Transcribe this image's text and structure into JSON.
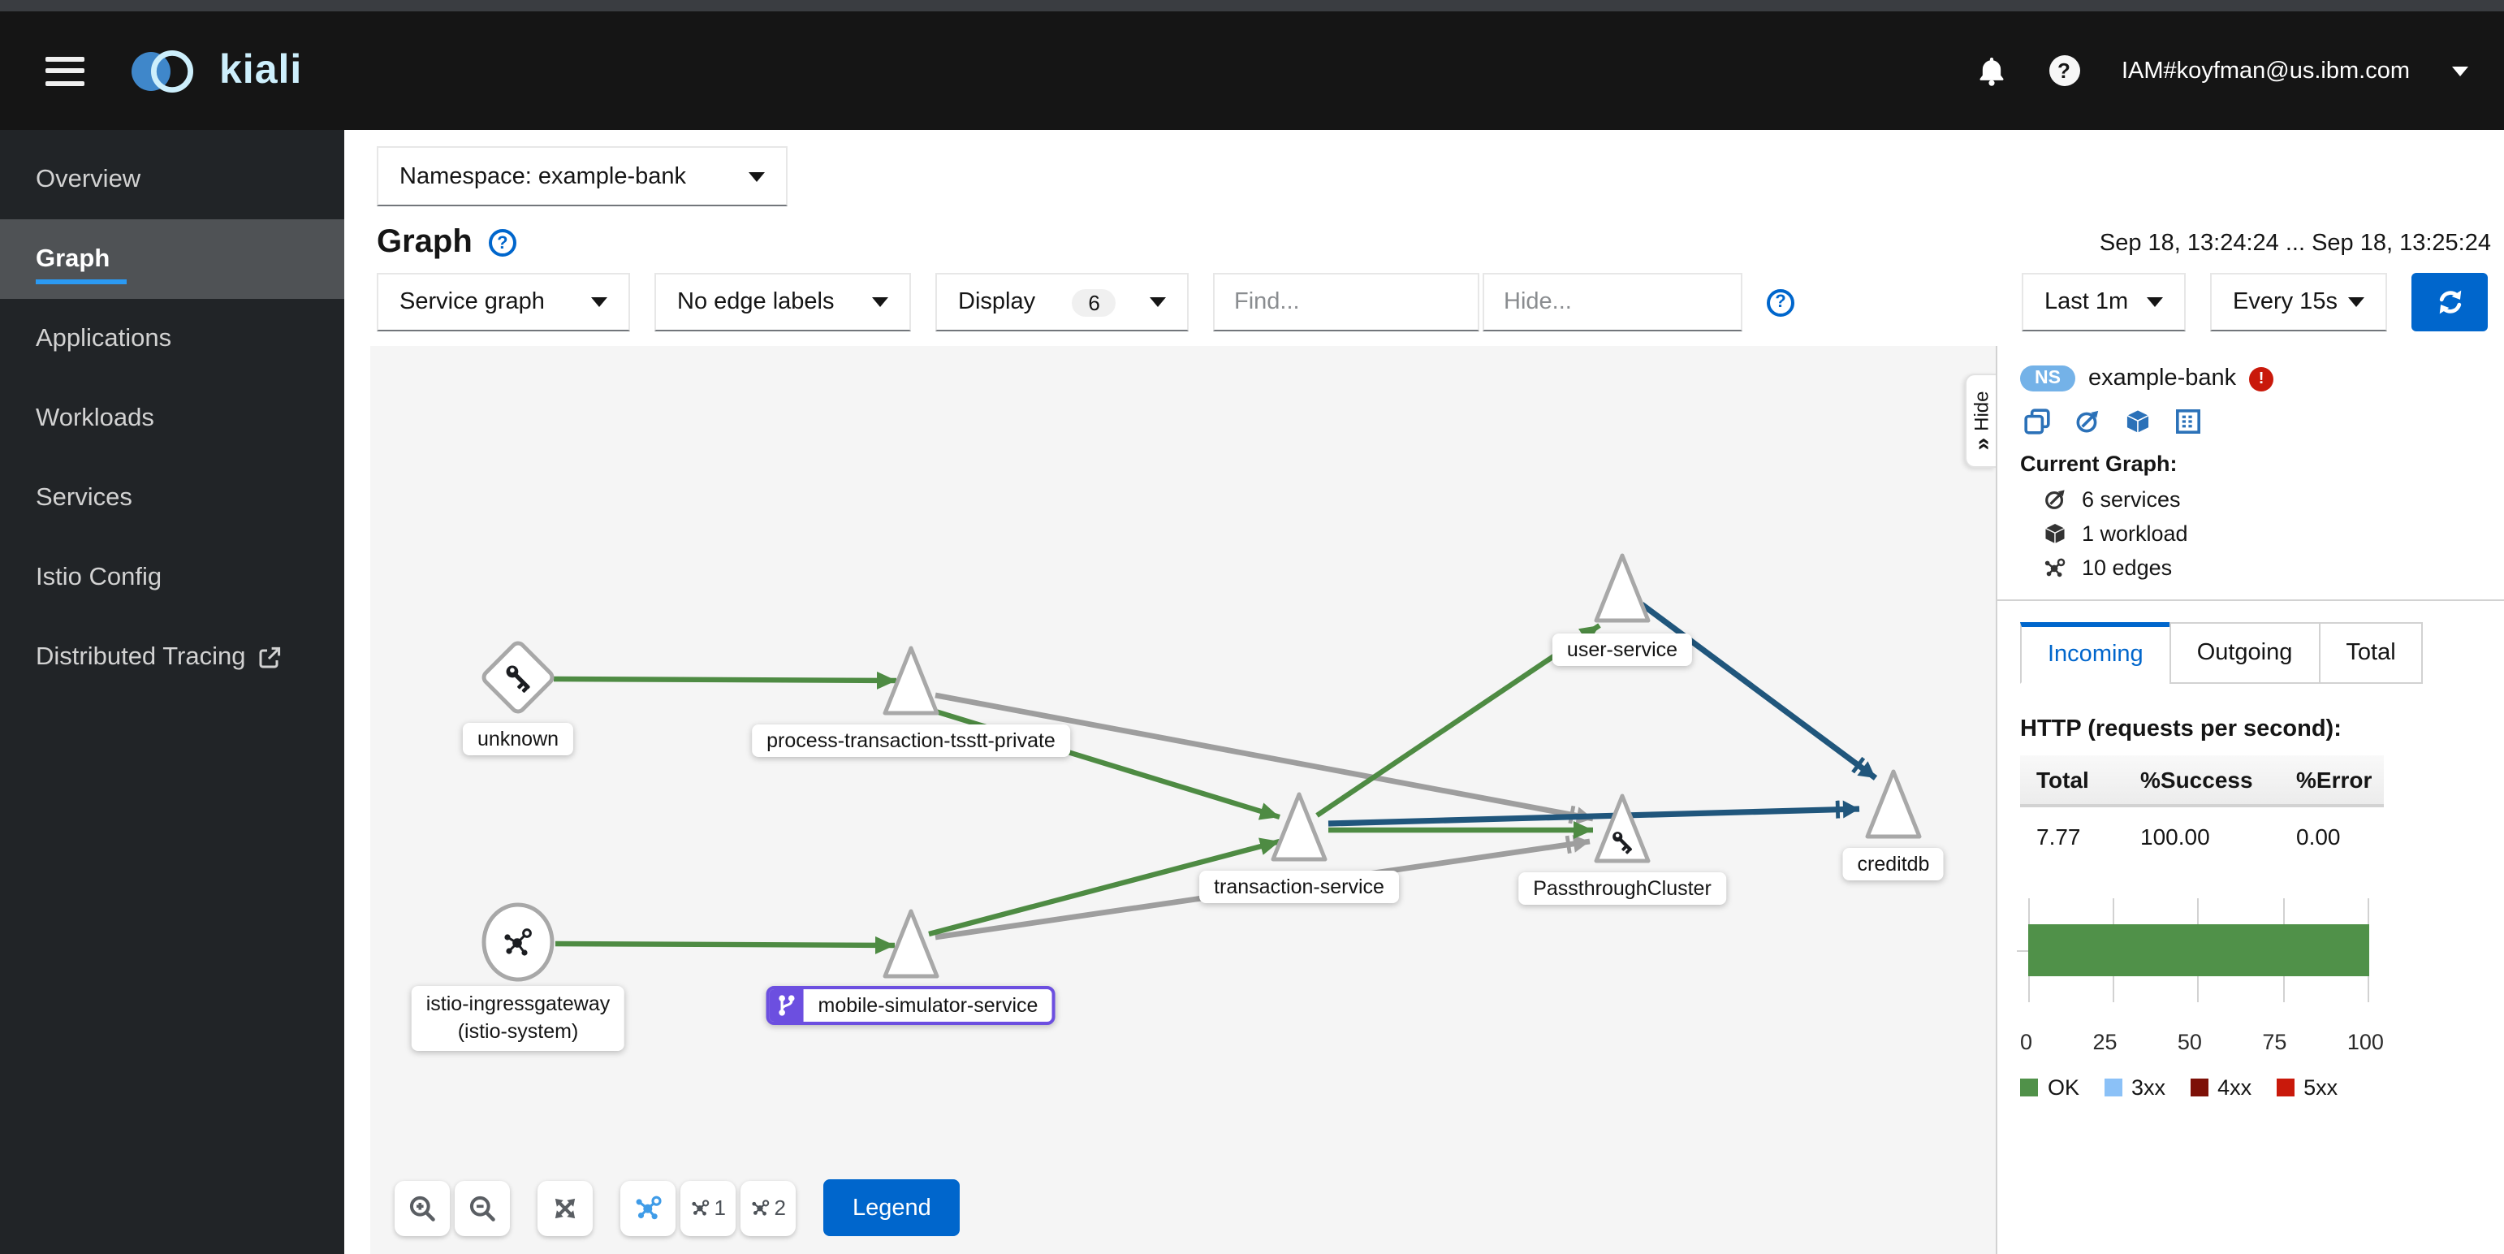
{
  "masthead": {
    "brand": "kiali",
    "user": "IAM#koyfman@us.ibm.com"
  },
  "sidebar": {
    "items": [
      {
        "label": "Overview"
      },
      {
        "label": "Graph"
      },
      {
        "label": "Applications"
      },
      {
        "label": "Workloads"
      },
      {
        "label": "Services"
      },
      {
        "label": "Istio Config"
      },
      {
        "label": "Distributed Tracing"
      }
    ],
    "active_item": "Graph"
  },
  "toolbar": {
    "namespace_select": "Namespace: example-bank",
    "page_title": "Graph",
    "graph_type_select": "Service graph",
    "edge_labels_select": "No edge labels",
    "display_select": "Display",
    "display_badge": "6",
    "find_placeholder": "Find...",
    "hide_placeholder": "Hide...",
    "time_range": "Sep 18, 13:24:24 ... Sep 18, 13:25:24",
    "duration_select": "Last 1m",
    "refresh_select": "Every 15s"
  },
  "graph": {
    "nodes": [
      {
        "label": "unknown",
        "shape": "diamond",
        "icon": "key"
      },
      {
        "label": "process-transaction-tsstt-private",
        "shape": "triangle"
      },
      {
        "label": "user-service",
        "shape": "triangle"
      },
      {
        "label": "transaction-service",
        "shape": "triangle"
      },
      {
        "label": "PassthroughCluster",
        "shape": "triangle",
        "icon": "key"
      },
      {
        "label": "creditdb",
        "shape": "triangle"
      },
      {
        "label": "istio-ingressgateway",
        "sublabel": "(istio-system)",
        "shape": "circle",
        "icon": "mesh"
      },
      {
        "label": "mobile-simulator-service",
        "shape": "triangle",
        "badge": "virtual-service"
      }
    ],
    "edges": [
      {
        "from": "unknown",
        "to": "process-transaction-tsstt-private",
        "protocol": "http",
        "status": "healthy"
      },
      {
        "from": "process-transaction-tsstt-private",
        "to": "transaction-service",
        "protocol": "http",
        "status": "healthy"
      },
      {
        "from": "process-transaction-tsstt-private",
        "to": "PassthroughCluster",
        "protocol": "http",
        "status": "idle"
      },
      {
        "from": "istio-ingressgateway",
        "to": "mobile-simulator-service",
        "protocol": "http",
        "status": "healthy"
      },
      {
        "from": "mobile-simulator-service",
        "to": "transaction-service",
        "protocol": "http",
        "status": "healthy"
      },
      {
        "from": "mobile-simulator-service",
        "to": "PassthroughCluster",
        "protocol": "http",
        "status": "idle"
      },
      {
        "from": "transaction-service",
        "to": "user-service",
        "protocol": "http",
        "status": "healthy"
      },
      {
        "from": "transaction-service",
        "to": "PassthroughCluster",
        "protocol": "http",
        "status": "healthy"
      },
      {
        "from": "transaction-service",
        "to": "creditdb",
        "protocol": "tcp"
      },
      {
        "from": "user-service",
        "to": "creditdb",
        "protocol": "tcp"
      }
    ],
    "hide_tab": "Hide",
    "gtoolbar": {
      "layout1_label": "1",
      "layout2_label": "2",
      "legend_button": "Legend"
    }
  },
  "side_panel": {
    "ns_badge": "NS",
    "namespace": "example-bank",
    "current_graph_title": "Current Graph:",
    "stats": [
      {
        "label": "6 services"
      },
      {
        "label": "1 workload"
      },
      {
        "label": "10 edges"
      }
    ],
    "tabs": [
      {
        "label": "Incoming"
      },
      {
        "label": "Outgoing"
      },
      {
        "label": "Total"
      }
    ],
    "active_tab": "Incoming",
    "http_title": "HTTP (requests per second):",
    "table": {
      "headers": [
        "Total",
        "%Success",
        "%Error"
      ],
      "row": [
        "7.77",
        "100.00",
        "0.00"
      ]
    },
    "chart_data": {
      "type": "bar",
      "orientation": "horizontal",
      "stacked": true,
      "xlim": [
        0,
        100
      ],
      "ticks": [
        "0",
        "25",
        "50",
        "75",
        "100"
      ],
      "grid": true,
      "legend_position": "bottom",
      "series": [
        {
          "name": "OK",
          "value": 100,
          "color": "#509149"
        },
        {
          "name": "3xx",
          "value": 0,
          "color": "#8bc1f7"
        },
        {
          "name": "4xx",
          "value": 0,
          "color": "#7d1007"
        },
        {
          "name": "5xx",
          "value": 0,
          "color": "#c9190b"
        }
      ]
    }
  },
  "colors": {
    "primary_blue": "#0066cc",
    "nav_active_blue": "#2b9af3",
    "edge_healthy_green": "#4e8b43",
    "edge_idle_gray": "#9e9e9e",
    "edge_tcp_blue": "#20567c",
    "virtual_service_purple": "#6c4fe0",
    "error_red": "#c9190b",
    "ns_badge_blue": "#74b2e8",
    "canvas_bg": "#f5f5f5",
    "masthead_bg": "#151515",
    "sidebar_bg": "#212427"
  }
}
